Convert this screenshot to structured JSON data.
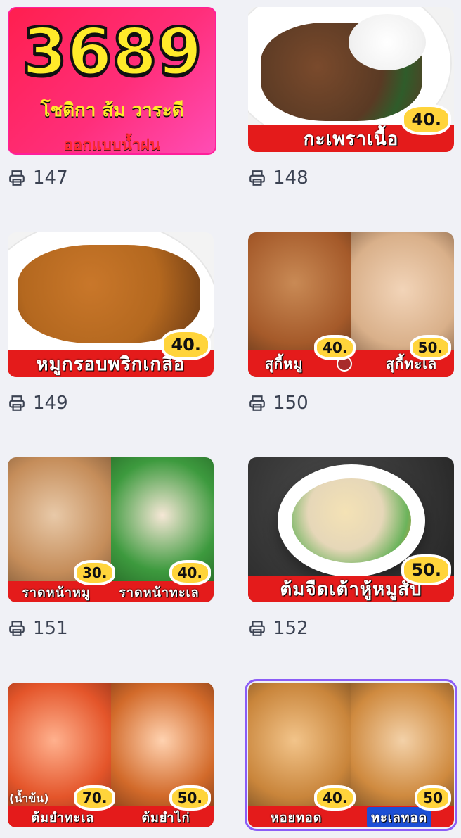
{
  "items": [
    {
      "id": "147",
      "type": "promo",
      "big_number": "3689",
      "line1": "โชติกา ส้ม วาระดี",
      "line2": "ออกแบบน้ำฝน",
      "count": "147"
    },
    {
      "id": "148",
      "banner": "กะเพราเนื้อ",
      "price": "40.",
      "count": "148",
      "colors": {
        "bg": "#5a3a24",
        "accent": "#c52f1f"
      }
    },
    {
      "id": "149",
      "banner": "หมูกรอบพริกเกลือ",
      "price": "40.",
      "count": "149",
      "colors": {
        "bg": "#b4681f",
        "accent": "#e5e1dc"
      }
    },
    {
      "id": "150",
      "left_label": "สุกี้หมู",
      "right_label": "สุกี้ทะเล",
      "left_price": "40.",
      "right_price": "50.",
      "count": "150",
      "colors": {
        "left": "#a55a2a",
        "right": "#d9b08a"
      }
    },
    {
      "id": "151",
      "left_label": "ราดหน้าหมู",
      "right_label": "ราดหน้าทะเล",
      "left_price": "30.",
      "right_price": "40.",
      "count": "151",
      "colors": {
        "left": "#c58d5a",
        "right": "#3d9a3e"
      }
    },
    {
      "id": "152",
      "banner": "ต้มจืดเต้าหู้หมูสับ",
      "price": "50.",
      "count": "152",
      "colors": {
        "bg": "#2f2f2f",
        "accent": "#e6d7b8"
      }
    },
    {
      "id": "153",
      "left_label": "ต้มยำทะเล",
      "right_label": "ต้มยำไก่",
      "left_extra": "(น้ำข้น)",
      "left_price": "70.",
      "right_price": "50.",
      "colors": {
        "left": "#e4552a",
        "right": "#d26a2a"
      }
    },
    {
      "id": "154",
      "left_label": "หอยทอด",
      "right_label": "ทะเลทอด",
      "left_price": "40.",
      "right_price": "50",
      "colors": {
        "left": "#c9853b",
        "right": "#cf8a3f",
        "selected": "#8b5cf6"
      }
    }
  ]
}
